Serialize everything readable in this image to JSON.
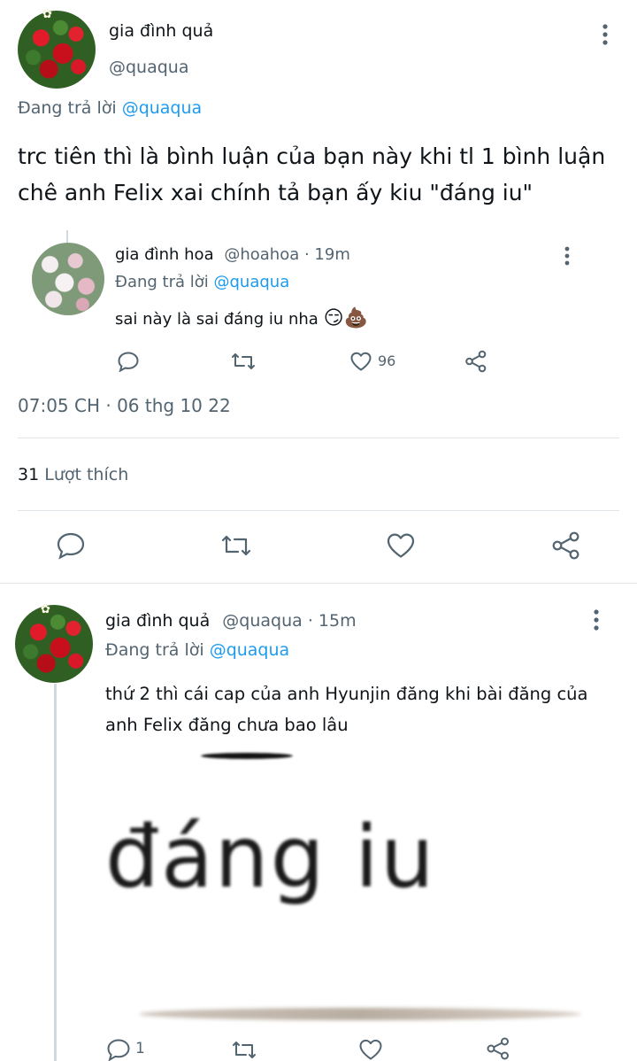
{
  "main_tweet": {
    "author_name": "gia đình quả",
    "author_handle": "@quaqua",
    "replying_label": "Đang trả lời",
    "replying_to": "@quaqua",
    "text": "trc tiên thì là bình luận của bạn này khi tl 1 bình luận chê anh Felix xai chính tả bạn ấy kiu \"đáng iu\"",
    "timestamp": "07:05 CH · 06 thg 10 22",
    "likes_count": "31",
    "likes_label": "Lượt thích"
  },
  "quoted_reply": {
    "author_name": "gia đình hoa",
    "author_handle": "@hoahoa",
    "time": "· 19m",
    "replying_label": "Đang trả lời",
    "replying_to": "@quaqua",
    "text": "sai này là sai đáng iu nha",
    "emoji": "😏💩",
    "like_count": "96"
  },
  "second_tweet": {
    "author_name": "gia đình quả",
    "author_handle": "@quaqua",
    "time": "· 15m",
    "replying_label": "Đang trả lời",
    "replying_to": "@quaqua",
    "text": "thứ 2 thì cái cap của anh Hyunjin đăng khi bài đăng của anh Felix đăng chưa bao lâu",
    "image_text": "đáng iu",
    "reply_count": "1"
  },
  "icons": [
    "more-vertical-icon",
    "reply-icon",
    "retweet-icon",
    "like-icon",
    "share-icon"
  ],
  "colors": {
    "link": "#1d9bf0",
    "muted": "#536471",
    "divider": "#e1e6ea"
  }
}
